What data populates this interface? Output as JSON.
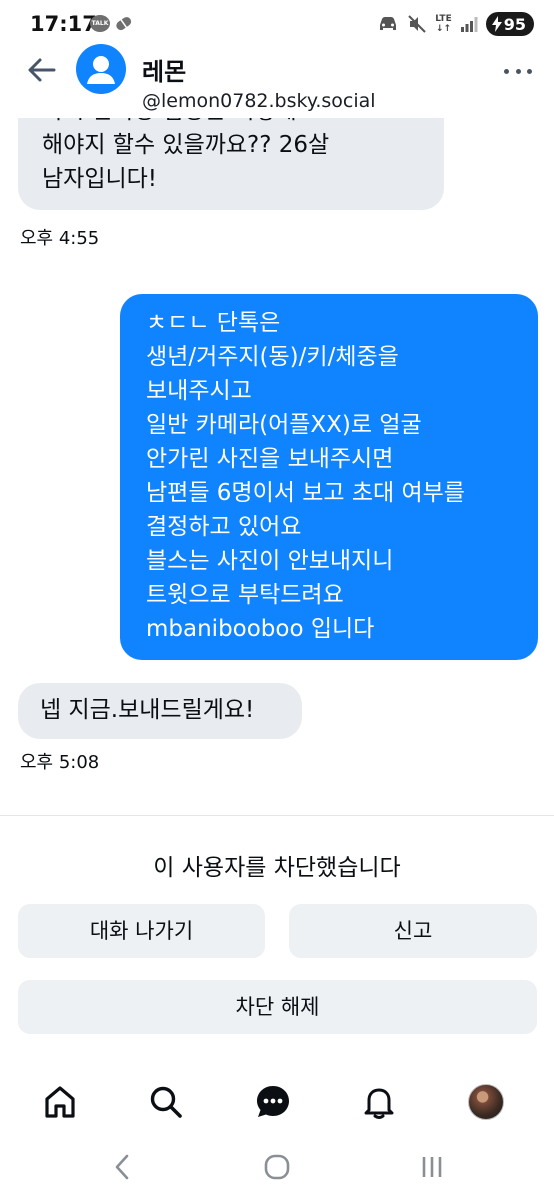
{
  "status_bar": {
    "time": "17:17",
    "talk_badge": "TALK",
    "network": "LTE",
    "battery": "95"
  },
  "header": {
    "name": "레몬",
    "handle": "@lemon0782.bsky.social"
  },
  "messages": [
    {
      "direction": "incoming",
      "lines": [
        "혹시 단톡방 입장은 어떻게",
        "해야지 할수 있을까요?? 26살",
        "남자입니다!"
      ],
      "time": "오후 4:55"
    },
    {
      "direction": "outgoing",
      "lines": [
        "ㅊㄷㄴ 단톡은",
        "생년/거주지(동)/키/체중을",
        "보내주시고",
        "일반 카메라(어플XX)로 얼굴",
        "안가린 사진을 보내주시면",
        "남편들 6명이서 보고 초대 여부를",
        "결정하고 있어요",
        "블스는 사진이 안보내지니",
        "트윗으로 부탁드려요",
        "mbanibooboo 입니다"
      ]
    },
    {
      "direction": "incoming",
      "lines": [
        "넵 지금.보내드릴게요!"
      ],
      "time": "오후 5:08"
    }
  ],
  "blocked": {
    "message": "이 사용자를 차단했습니다",
    "leave_label": "대화 나가기",
    "report_label": "신고",
    "unblock_label": "차단 해제"
  },
  "colors": {
    "accent": "#1083fe",
    "incoming_bubble": "#e8ecf0",
    "button_bg": "#eef1f4"
  },
  "icons": {
    "back": "arrow-left-icon",
    "more": "more-horizontal-icon",
    "home": "home-icon",
    "search": "search-icon",
    "chat": "chat-icon",
    "notifications": "bell-icon"
  }
}
